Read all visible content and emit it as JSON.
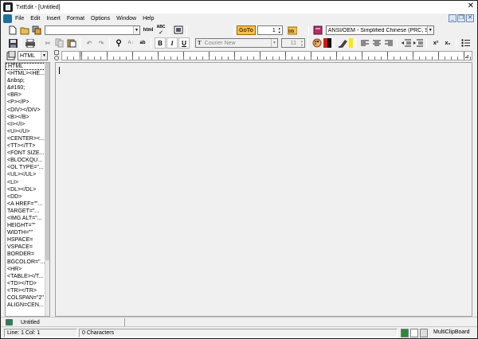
{
  "window": {
    "title": "TxtEdit - [Untitled]"
  },
  "menu": [
    "File",
    "Edit",
    "Insert",
    "Format",
    "Options",
    "Window",
    "Help"
  ],
  "toolbar1": {
    "style_combo": "",
    "html_btn": "html",
    "abc_btn": "ABC",
    "goto_btn": "GoTo",
    "goto_value": "1",
    "encoding_combo": "ANSI/OEM - Simplified Chinese (PRC, Singapore)"
  },
  "toolbar2": {
    "bold": "B",
    "italic": "I",
    "underline": "U",
    "font_name": "Courier New",
    "font_size": "11",
    "superscript": "x²",
    "subscript": "x₂"
  },
  "tag_panel": {
    "selector": "HTML",
    "items": [
      "HTML",
      "<HTML><HE...",
      "&nbsp;",
      "&#160;",
      "<BR>",
      "<P></P>",
      "<DIV></DIV>",
      "<B></B>",
      "<I></I>",
      "<U></U>",
      "<CENTER><...",
      "<TT></TT>",
      "<FONT SIZE...",
      "<BLOCKQU...",
      "<OL TYPE=\"...",
      "<UL></UL>",
      "<LI>",
      "<DL></DL>",
      "<DD>",
      "<A HREF=\"\"...",
      "TARGET=\"...",
      "<IMG ALT=\"...",
      "HEIGHT=\"\"",
      "WIDTH=\"\"",
      "HSPACE=",
      "VSPACE=",
      "BORDER=",
      "BGCOLOR=\"...",
      "<HR>",
      "<TABLE></T...",
      "<TD></TD>",
      "<TR></TR>",
      "COLSPAN=\"2\"",
      "ALIGN=CEN..."
    ]
  },
  "doc_tabs": {
    "active": "Untitled"
  },
  "status": {
    "position": "Line: 1  Col: 1",
    "chars": "0 Characters",
    "clipboard": "MultiClipBoard"
  }
}
